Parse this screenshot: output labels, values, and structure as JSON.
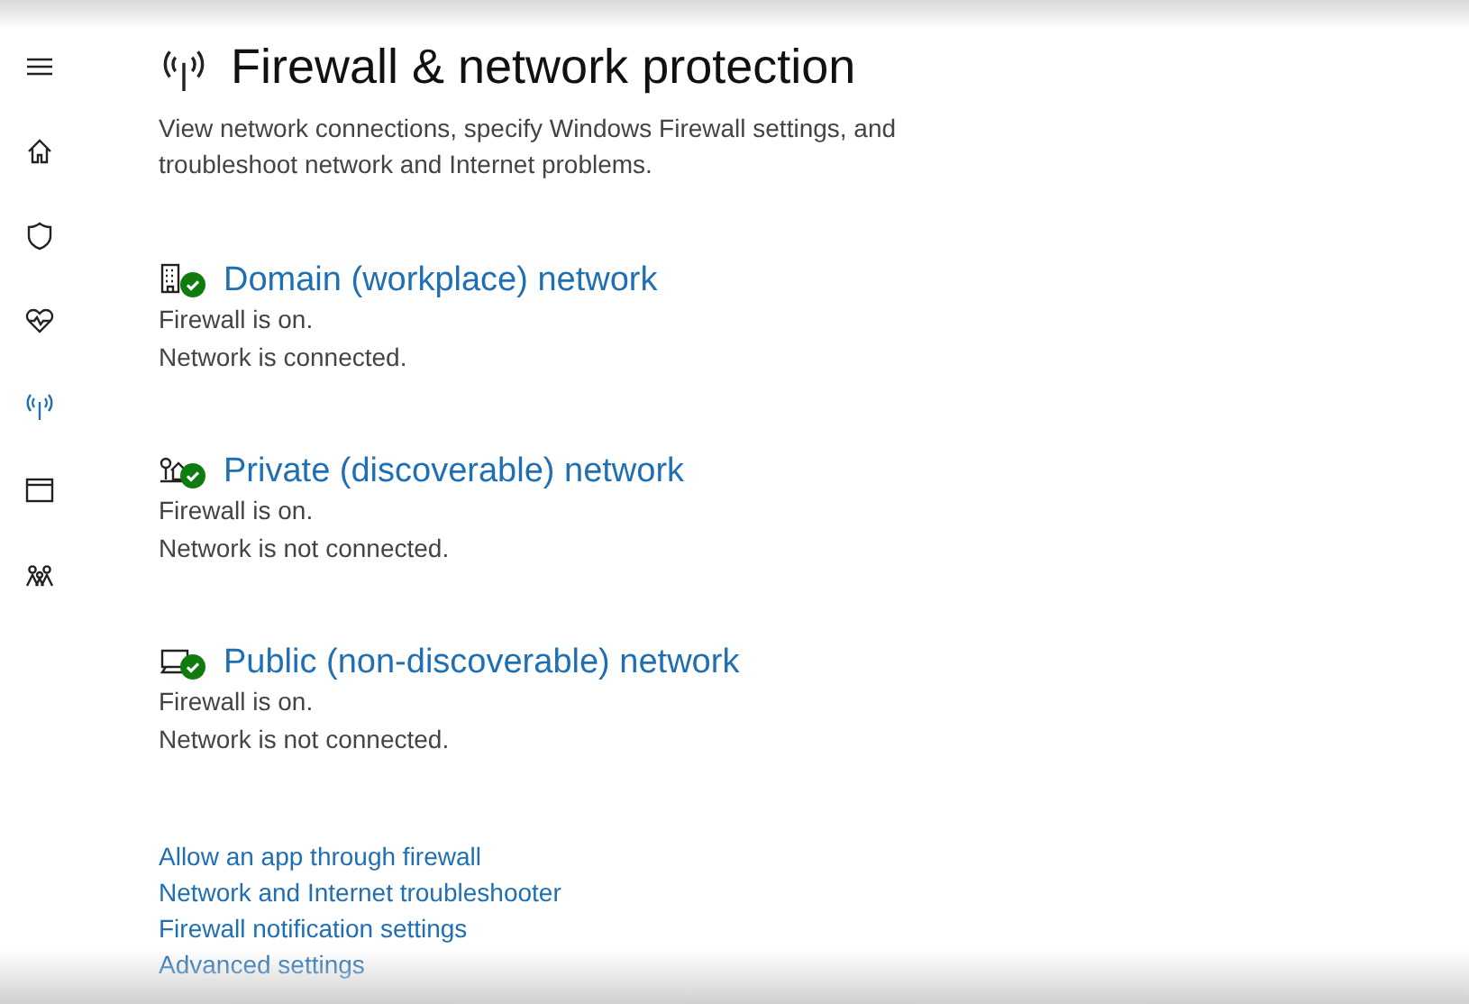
{
  "sidebar": {
    "items": [
      {
        "kind": "menu",
        "selected": false
      },
      {
        "kind": "home",
        "selected": false
      },
      {
        "kind": "shield",
        "selected": false
      },
      {
        "kind": "health",
        "selected": false
      },
      {
        "kind": "network",
        "selected": true
      },
      {
        "kind": "browser",
        "selected": false
      },
      {
        "kind": "family",
        "selected": false
      }
    ]
  },
  "page": {
    "title": "Firewall & network protection",
    "description": "View network connections, specify Windows Firewall settings, and troubleshoot network and Internet problems."
  },
  "networks": [
    {
      "kind": "domain",
      "name": "Domain (workplace) network",
      "ok": true,
      "firewall": "Firewall is on.",
      "connection": "Network is connected."
    },
    {
      "kind": "private",
      "name": "Private (discoverable) network",
      "ok": true,
      "firewall": "Firewall is on.",
      "connection": "Network is not connected."
    },
    {
      "kind": "public",
      "name": "Public (non-discoverable) network",
      "ok": true,
      "firewall": "Firewall is on.",
      "connection": "Network is not connected."
    }
  ],
  "links": [
    "Allow an app through firewall",
    "Network and Internet troubleshooter",
    "Firewall notification settings",
    "Advanced settings"
  ]
}
